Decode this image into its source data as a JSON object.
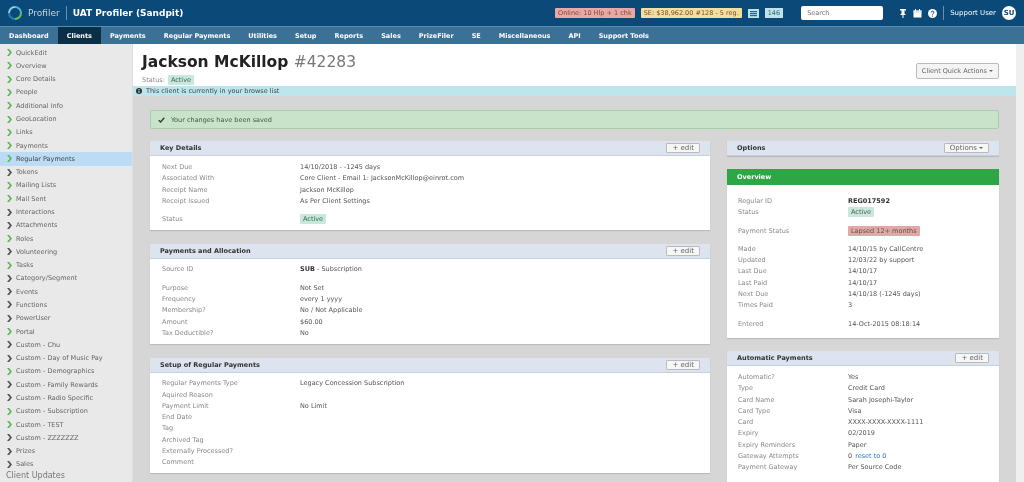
{
  "header": {
    "brand": "Profiler",
    "title": "UAT Profiler (Sandpit)",
    "badges": [
      {
        "text": "Online: 10 Hlp + 1 chk",
        "color": "#e8a8a8"
      },
      {
        "text": "SE: $38,962.00 #128 - 5 reg.",
        "color": "#f3dfa0"
      }
    ],
    "list_count": "146",
    "search": {
      "placeholder": "Search"
    },
    "user": "Support User",
    "avatar": "SU"
  },
  "nav": [
    {
      "label": "Dashboard",
      "selected": false
    },
    {
      "label": "Clients",
      "selected": true
    },
    {
      "label": "Payments",
      "selected": false
    },
    {
      "label": "Regular Payments",
      "selected": false
    },
    {
      "label": "Utilities",
      "selected": false
    },
    {
      "label": "Setup",
      "selected": false
    },
    {
      "label": "Reports",
      "selected": false
    },
    {
      "label": "Sales",
      "selected": false
    },
    {
      "label": "PrizeFiler",
      "selected": false
    },
    {
      "label": "SE",
      "selected": false
    },
    {
      "label": "Miscellaneous",
      "selected": false
    },
    {
      "label": "API",
      "selected": false
    },
    {
      "label": "Support Tools",
      "selected": false
    }
  ],
  "sidebar": {
    "items": [
      {
        "label": "QuickEdit",
        "selected": false,
        "color": "#5cb85c"
      },
      {
        "label": "Overview",
        "selected": false,
        "color": "#5cb85c"
      },
      {
        "label": "Core Details",
        "selected": false,
        "color": "#5cb85c"
      },
      {
        "label": "People",
        "selected": false,
        "color": "#5cb85c"
      },
      {
        "label": "Additional Info",
        "selected": false,
        "color": "#5cb85c"
      },
      {
        "label": "GeoLocation",
        "selected": false,
        "color": "#5cb85c"
      },
      {
        "label": "Links",
        "selected": false,
        "color": "#5cb85c"
      },
      {
        "label": "Payments",
        "selected": false,
        "color": "#5cb85c"
      },
      {
        "label": "Regular Payments",
        "selected": true,
        "color": "#5cb85c"
      },
      {
        "label": "Tokens",
        "selected": false,
        "color": "#555555"
      },
      {
        "label": "Mailing Lists",
        "selected": false,
        "color": "#5cb85c"
      },
      {
        "label": "Mail Sent",
        "selected": false,
        "color": "#5cb85c"
      },
      {
        "label": "Interactions",
        "selected": false,
        "color": "#555555"
      },
      {
        "label": "Attachments",
        "selected": false,
        "color": "#555555"
      },
      {
        "label": "Roles",
        "selected": false,
        "color": "#5cb85c"
      },
      {
        "label": "Volunteering",
        "selected": false,
        "color": "#555555"
      },
      {
        "label": "Tasks",
        "selected": false,
        "color": "#5cb85c"
      },
      {
        "label": "Category/Segment",
        "selected": false,
        "color": "#555555"
      },
      {
        "label": "Events",
        "selected": false,
        "color": "#555555"
      },
      {
        "label": "Functions",
        "selected": false,
        "color": "#555555"
      },
      {
        "label": "PowerUser",
        "selected": false,
        "color": "#555555"
      },
      {
        "label": "Portal",
        "selected": false,
        "color": "#5cb85c"
      },
      {
        "label": "Custom - Chu",
        "selected": false,
        "color": "#555555"
      },
      {
        "label": "Custom - Day of Music Pay",
        "selected": false,
        "color": "#555555"
      },
      {
        "label": "Custom - Demographics",
        "selected": false,
        "color": "#5cb85c"
      },
      {
        "label": "Custom - Family Rewards",
        "selected": false,
        "color": "#555555"
      },
      {
        "label": "Custom - Radio Specific",
        "selected": false,
        "color": "#555555"
      },
      {
        "label": "Custom - Subscription",
        "selected": false,
        "color": "#5cb85c"
      },
      {
        "label": "Custom - TEST",
        "selected": false,
        "color": "#5cb85c"
      },
      {
        "label": "Custom - ZZZZZZZ",
        "selected": false,
        "color": "#555555"
      },
      {
        "label": "Prizes",
        "selected": false,
        "color": "#555555"
      },
      {
        "label": "Sales",
        "selected": false,
        "color": "#555555"
      }
    ],
    "footer": "Client Updates"
  },
  "client": {
    "name": "Jackson McKillop",
    "number": "#42283",
    "status_label": "Status:",
    "status": "Active",
    "quick_actions": "Client Quick Actions"
  },
  "info_bar": "This client is currently in your browse list",
  "alert": "Your changes have been saved",
  "left_panels": [
    {
      "title": "Key Details",
      "kind": "standard",
      "button": "+ edit",
      "groups": [
        [
          {
            "label": "Next Due",
            "value": "14/10/2018 - -1245 days",
            "kind": "text"
          },
          {
            "label": "Associated With",
            "value": "Core Client - Email 1: JacksonMcKillop@einrot.com",
            "kind": "text"
          },
          {
            "label": "Receipt Name",
            "value": "Jackson McKillop",
            "kind": "text"
          },
          {
            "label": "Receipt Issued",
            "value": "As Per Client Settings",
            "kind": "text"
          }
        ],
        [
          {
            "label": "Status",
            "value": "Active",
            "kind": "badge",
            "color": "#c9e8dc"
          }
        ]
      ]
    },
    {
      "title": "Payments and Allocation",
      "kind": "standard",
      "button": "+ edit",
      "groups": [
        [
          {
            "label": "Source ID",
            "value": "**SUB** - Subscription",
            "kind": "text"
          }
        ],
        [
          {
            "label": "Purpose",
            "value": "Not Set",
            "kind": "text"
          },
          {
            "label": "Frequency",
            "value": "every 1 yyyy",
            "kind": "text"
          },
          {
            "label": "Membership?",
            "value": "No / Not Applicable",
            "kind": "text"
          },
          {
            "label": "Amount",
            "value": "$60.00",
            "kind": "text"
          },
          {
            "label": "Tax Deductible?",
            "value": "No",
            "kind": "text"
          }
        ]
      ]
    },
    {
      "title": "Setup of Regular Payments",
      "kind": "standard",
      "button": "+ edit",
      "groups": [
        [
          {
            "label": "Regular Payments Type",
            "value": "Legacy Concession Subscription",
            "kind": "text"
          },
          {
            "label": "Aquired Reason",
            "kind": "text"
          },
          {
            "label": "Payment Limit",
            "value": "No Limit",
            "kind": "text"
          },
          {
            "label": "End Date",
            "kind": "text"
          },
          {
            "label": "Tag",
            "kind": "text"
          },
          {
            "label": "Archived Tag",
            "kind": "text"
          },
          {
            "label": "Externally Processed?",
            "kind": "text"
          },
          {
            "label": "Comment",
            "kind": "text"
          }
        ]
      ]
    }
  ],
  "right_panels": [
    {
      "title": "Options",
      "kind": "standard",
      "dropdown": "Options"
    },
    {
      "title": "Overview",
      "kind": "highlight",
      "groups": [
        [
          {
            "label": "Regular ID",
            "value": "**REG017592**",
            "kind": "text"
          },
          {
            "label": "Status",
            "value": "Active",
            "kind": "badge",
            "color": "#c9e8dc"
          }
        ],
        [
          {
            "label": "Payment Status",
            "value": "Lapsed 12+ months",
            "kind": "badge",
            "color": "#e6a6a6"
          }
        ],
        [
          {
            "label": "Made",
            "value": "14/10/15 by CallCentre",
            "kind": "text"
          },
          {
            "label": "Updated",
            "value": "12/03/22 by support",
            "kind": "text"
          },
          {
            "label": "Last Due",
            "value": "14/10/17",
            "kind": "text"
          },
          {
            "label": "Last Paid",
            "value": "14/10/17",
            "kind": "text"
          },
          {
            "label": "Next Due",
            "value": "14/10/18 (-1245 days)",
            "kind": "text"
          },
          {
            "label": "Times Paid",
            "value": "3",
            "kind": "text"
          }
        ],
        [
          {
            "label": "Entered",
            "value": "14-Oct-2015 08:18:14",
            "kind": "text"
          }
        ]
      ]
    },
    {
      "title": "Automatic Payments",
      "kind": "standard",
      "button": "+ edit",
      "groups": [
        [
          {
            "label": "Automatic?",
            "value": "Yes",
            "kind": "text"
          },
          {
            "label": "Type",
            "value": "Credit Card",
            "kind": "text"
          },
          {
            "label": "Card Name",
            "value": "Sarah Josephi-Taylor",
            "kind": "text"
          },
          {
            "label": "Card Type",
            "value": "Visa",
            "kind": "text"
          },
          {
            "label": "Card",
            "value": "XXXX-XXXX-XXXX-1111",
            "kind": "text"
          },
          {
            "label": "Expiry",
            "value": "02/2019",
            "kind": "text"
          },
          {
            "label": "Expiry Reminders",
            "value": "Paper",
            "kind": "text"
          },
          {
            "label": "Gateway Attempts",
            "value": "0",
            "link": "reset to 0",
            "kind": "link"
          },
          {
            "label": "Payment Gateway",
            "value": "Per Source Code",
            "kind": "text"
          }
        ]
      ]
    }
  ]
}
